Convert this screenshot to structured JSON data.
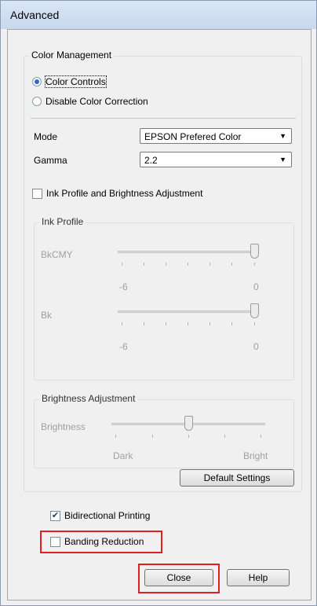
{
  "window": {
    "title": "Advanced"
  },
  "color_management": {
    "label": "Color Management",
    "radio_color_controls": "Color Controls",
    "radio_disable": "Disable Color Correction",
    "mode_label": "Mode",
    "mode_value": "EPSON Prefered Color",
    "gamma_label": "Gamma",
    "gamma_value": "2.2",
    "ink_check_label": "Ink Profile and Brightness Adjustment",
    "ink_profile": {
      "label": "Ink Profile",
      "bkcmy_label": "BkCMY",
      "bkcmy_min": "-6",
      "bkcmy_max": "0",
      "bk_label": "Bk",
      "bk_min": "-6",
      "bk_max": "0"
    },
    "brightness": {
      "label": "Brightness Adjustment",
      "brightness_label": "Brightness",
      "min_label": "Dark",
      "max_label": "Bright"
    },
    "default_button": "Default Settings"
  },
  "options": {
    "bidirectional": {
      "label": "Bidirectional Printing",
      "checked": true
    },
    "banding": {
      "label": "Banding Reduction",
      "checked": false
    }
  },
  "buttons": {
    "close": "Close",
    "help": "Help"
  },
  "colors": {
    "highlight": "#e02020",
    "accent": "#2d6acb"
  }
}
